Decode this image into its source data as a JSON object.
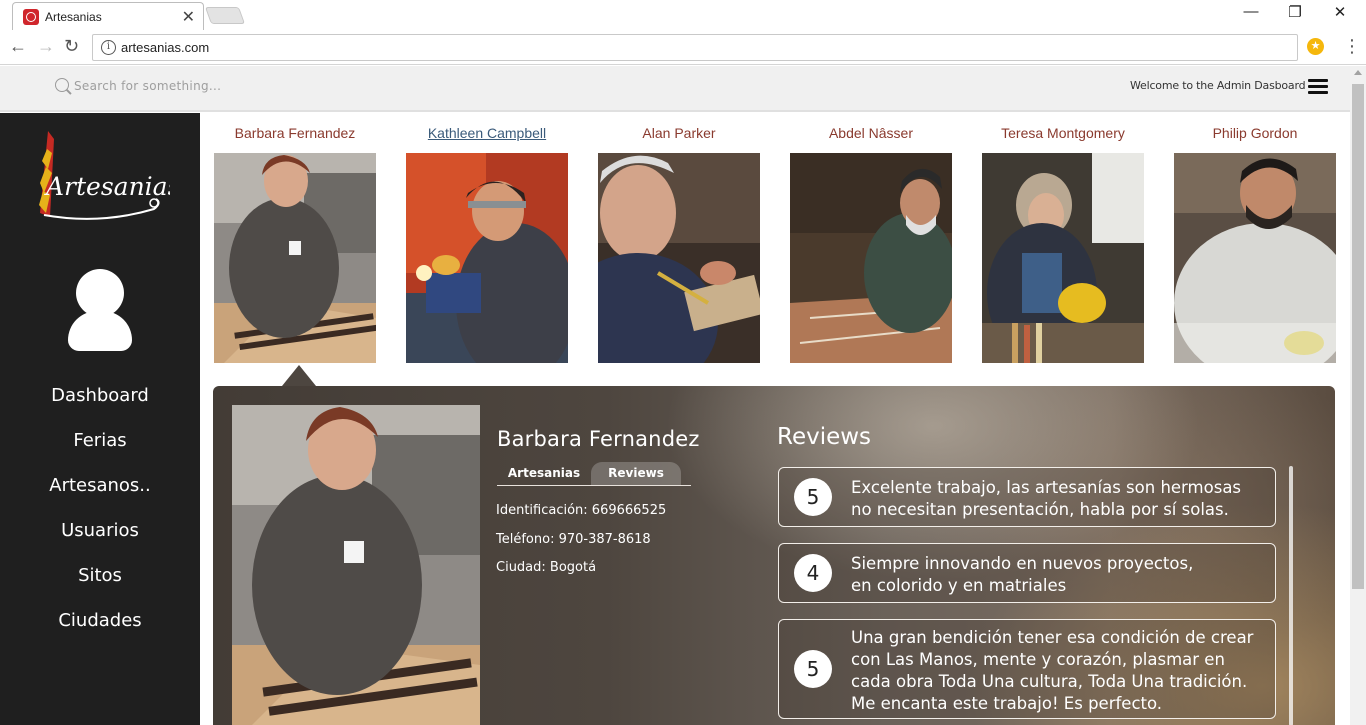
{
  "browser": {
    "tab_title": "Artesanias",
    "url": "artesanias.com",
    "close_glyph": "✕",
    "minimize_glyph": "—",
    "maximize_glyph": "❐",
    "window_close_glyph": "✕"
  },
  "header": {
    "search_placeholder": "Search for something...",
    "welcome_text": "Welcome to the Admin Dasboard"
  },
  "sidebar": {
    "logo_text": "Artesanias",
    "items": [
      {
        "label": "Dashboard"
      },
      {
        "label": "Ferias"
      },
      {
        "label": "Artesanos.."
      },
      {
        "label": "Usuarios"
      },
      {
        "label": "Sitos"
      },
      {
        "label": "Ciudades"
      }
    ]
  },
  "artisans": [
    {
      "name": "Barbara Fernandez",
      "active": false
    },
    {
      "name": "Kathleen Campbell",
      "active": true
    },
    {
      "name": "Alan Parker",
      "active": false
    },
    {
      "name": "Abdel Nâsser",
      "active": false
    },
    {
      "name": "Teresa Montgomery",
      "active": false
    },
    {
      "name": "Philip Gordon",
      "active": false
    }
  ],
  "detail": {
    "name": "Barbara Fernandez",
    "tabs": [
      "Artesanias",
      "Reviews"
    ],
    "selected_tab": "Reviews",
    "identificacion": "Identificación: 669666525",
    "telefono": "Teléfono: 970-387-8618",
    "ciudad": "Ciudad: Bogotá"
  },
  "reviews": {
    "title": "Reviews",
    "items": [
      {
        "score": "5",
        "text": "Excelente trabajo,  las artesanías son hermosas\nno necesitan presentación, habla por sí solas."
      },
      {
        "score": "4",
        "text": "Siempre innovando en nuevos proyectos,\nen colorido y en matriales"
      },
      {
        "score": "5",
        "text": "Una gran bendición tener esa condición de crear\ncon Las Manos, mente y corazón, plasmar en\ncada obra Toda Una cultura, Toda Una tradición.\nMe encanta este trabajo! Es perfecto."
      }
    ]
  }
}
